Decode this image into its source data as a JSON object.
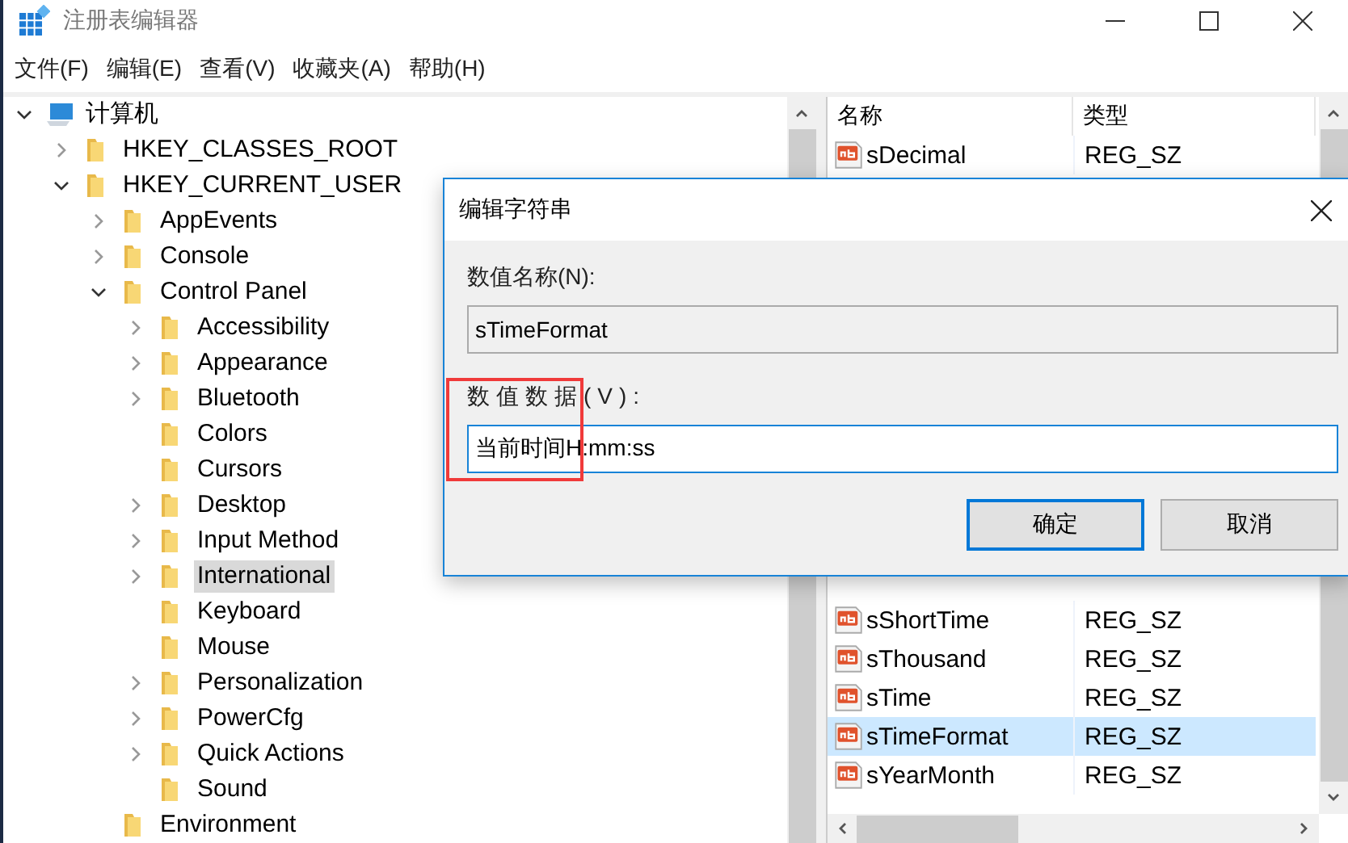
{
  "window": {
    "title": "注册表编辑器"
  },
  "menu": [
    "文件(F)",
    "编辑(E)",
    "查看(V)",
    "收藏夹(A)",
    "帮助(H)"
  ],
  "tree": [
    {
      "label": "计算机",
      "kind": "computer",
      "has_children": true,
      "expanded": true,
      "selected": false,
      "children": [
        {
          "label": "HKEY_CLASSES_ROOT",
          "kind": "folder",
          "has_children": true,
          "expanded": false,
          "selected": false
        },
        {
          "label": "HKEY_CURRENT_USER",
          "kind": "folder",
          "has_children": true,
          "expanded": true,
          "selected": false,
          "children": [
            {
              "label": "AppEvents",
              "kind": "folder",
              "has_children": true,
              "expanded": false,
              "selected": false
            },
            {
              "label": "Console",
              "kind": "folder",
              "has_children": true,
              "expanded": false,
              "selected": false
            },
            {
              "label": "Control Panel",
              "kind": "folder",
              "has_children": true,
              "expanded": true,
              "selected": false,
              "children": [
                {
                  "label": "Accessibility",
                  "kind": "folder",
                  "has_children": true,
                  "expanded": false,
                  "selected": false
                },
                {
                  "label": "Appearance",
                  "kind": "folder",
                  "has_children": true,
                  "expanded": false,
                  "selected": false
                },
                {
                  "label": "Bluetooth",
                  "kind": "folder",
                  "has_children": true,
                  "expanded": false,
                  "selected": false
                },
                {
                  "label": "Colors",
                  "kind": "folder",
                  "has_children": false,
                  "expanded": false,
                  "selected": false
                },
                {
                  "label": "Cursors",
                  "kind": "folder",
                  "has_children": false,
                  "expanded": false,
                  "selected": false
                },
                {
                  "label": "Desktop",
                  "kind": "folder",
                  "has_children": true,
                  "expanded": false,
                  "selected": false
                },
                {
                  "label": "Input Method",
                  "kind": "folder",
                  "has_children": true,
                  "expanded": false,
                  "selected": false
                },
                {
                  "label": "International",
                  "kind": "folder",
                  "has_children": true,
                  "expanded": false,
                  "selected": true
                },
                {
                  "label": "Keyboard",
                  "kind": "folder",
                  "has_children": false,
                  "expanded": false,
                  "selected": false
                },
                {
                  "label": "Mouse",
                  "kind": "folder",
                  "has_children": false,
                  "expanded": false,
                  "selected": false
                },
                {
                  "label": "Personalization",
                  "kind": "folder",
                  "has_children": true,
                  "expanded": false,
                  "selected": false
                },
                {
                  "label": "PowerCfg",
                  "kind": "folder",
                  "has_children": true,
                  "expanded": false,
                  "selected": false
                },
                {
                  "label": "Quick Actions",
                  "kind": "folder",
                  "has_children": true,
                  "expanded": false,
                  "selected": false
                },
                {
                  "label": "Sound",
                  "kind": "folder",
                  "has_children": false,
                  "expanded": false,
                  "selected": false
                }
              ]
            },
            {
              "label": "Environment",
              "kind": "folder",
              "has_children": false,
              "expanded": false,
              "selected": false
            }
          ]
        }
      ]
    }
  ],
  "values": {
    "columns": [
      "名称",
      "类型"
    ],
    "rows": [
      {
        "name": "sDecimal",
        "type": "REG_SZ",
        "selected": false
      },
      {
        "name": "sShortTime",
        "type": "REG_SZ",
        "selected": false
      },
      {
        "name": "sThousand",
        "type": "REG_SZ",
        "selected": false
      },
      {
        "name": "sTime",
        "type": "REG_SZ",
        "selected": false
      },
      {
        "name": "sTimeFormat",
        "type": "REG_SZ",
        "selected": true
      },
      {
        "name": "sYearMonth",
        "type": "REG_SZ",
        "selected": false
      }
    ]
  },
  "dialog": {
    "title": "编辑字符串",
    "name_label": "数值名称(N):",
    "name_value": "sTimeFormat",
    "data_label": "数值数据(V):",
    "data_value": "当前时间H:mm:ss",
    "buttons": [
      "确定",
      "取消"
    ]
  }
}
